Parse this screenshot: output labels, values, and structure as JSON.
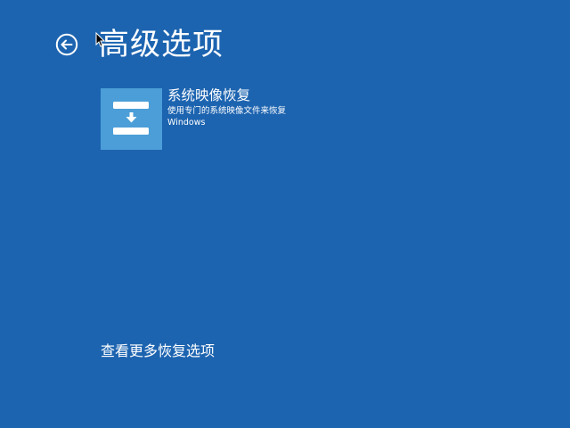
{
  "header": {
    "back_icon": "back-arrow-circle-icon",
    "title": "高级选项"
  },
  "options": [
    {
      "icon": "system-image-recovery-icon",
      "title": "系统映像恢复",
      "description": "使用专门的系统映像文件来恢复Windows"
    }
  ],
  "footer": {
    "more_link": "查看更多恢复选项"
  },
  "colors": {
    "background": "#1d64b0",
    "tile_icon_bg": "#4b9ed8",
    "text": "#ffffff"
  }
}
